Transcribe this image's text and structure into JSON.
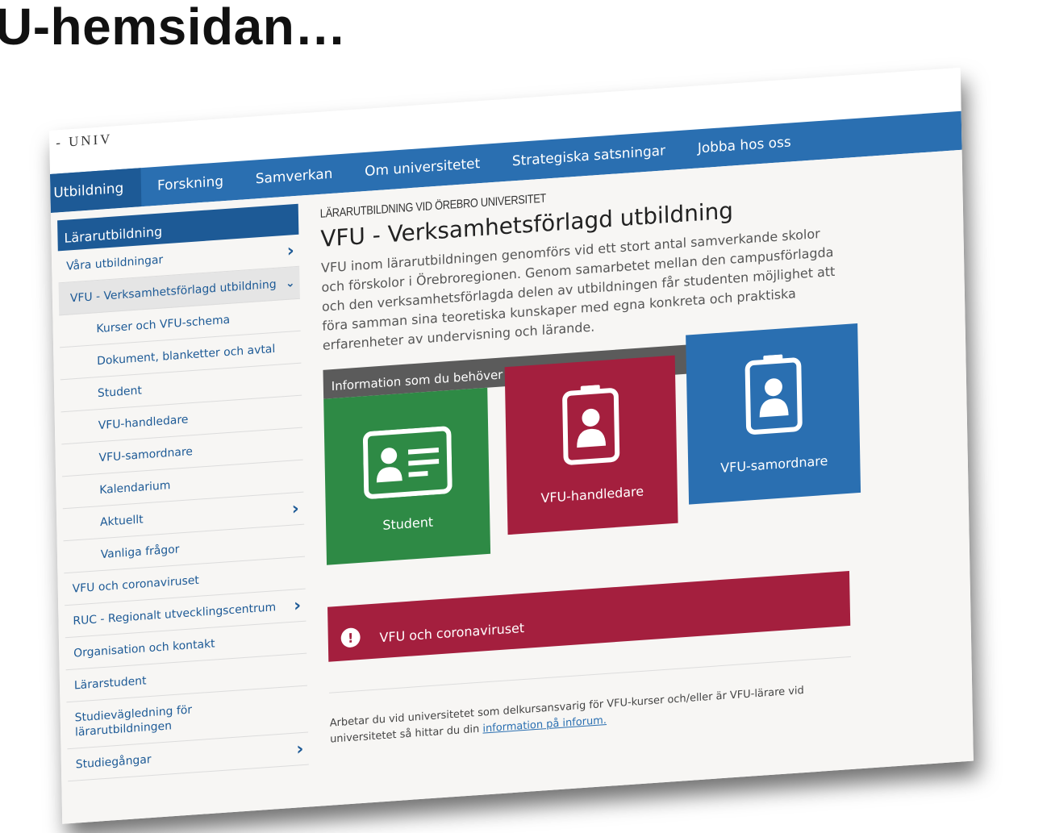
{
  "slide": {
    "title": "U-hemsidan…"
  },
  "site": {
    "logo_text": "- UNIV"
  },
  "topnav": [
    "Utbildning",
    "Forskning",
    "Samverkan",
    "Om universitetet",
    "Strategiska satsningar",
    "Jobba hos oss"
  ],
  "sidebar": {
    "heading": "Lärarutbildning",
    "items": [
      {
        "label": "Våra utbildningar",
        "level": 1,
        "chevron": "right"
      },
      {
        "label": "VFU - Verksamhetsförlagd utbildning",
        "level": 1,
        "chevron": "down",
        "active": true
      },
      {
        "label": "Kurser och VFU-schema",
        "level": 2
      },
      {
        "label": "Dokument, blanketter och avtal",
        "level": 2
      },
      {
        "label": "Student",
        "level": 2
      },
      {
        "label": "VFU-handledare",
        "level": 2
      },
      {
        "label": "VFU-samordnare",
        "level": 2
      },
      {
        "label": "Kalendarium",
        "level": 2
      },
      {
        "label": "Aktuellt",
        "level": 2,
        "chevron": "right"
      },
      {
        "label": "Vanliga frågor",
        "level": 2
      },
      {
        "label": "VFU och coronaviruset",
        "level": 1
      },
      {
        "label": "RUC - Regionalt utvecklingscentrum",
        "level": 1,
        "chevron": "right"
      },
      {
        "label": "Organisation och kontakt",
        "level": 1
      },
      {
        "label": "Lärarstudent",
        "level": 1
      },
      {
        "label": "Studievägledning för lärarutbildningen",
        "level": 1
      },
      {
        "label": "Studiegångar",
        "level": 1,
        "chevron": "right"
      }
    ]
  },
  "main": {
    "kicker": "LÄRARUTBILDNING VID ÖREBRO UNIVERSITET",
    "heading": "VFU - Verksamhetsförlagd utbildning",
    "lead": "VFU inom lärarutbildningen genomförs vid ett stort antal samverkande skolor och förskolor i Örebroregionen. Genom samarbetet mellan den campusförlagda och den verksamhetsförlagda delen av utbildningen får studenten möjlighet att föra samman sina teoretiska kunskaper med egna konkreta och praktiska erfarenheter av undervisning och lärande.",
    "info_heading": "Information som du behöver",
    "tiles": [
      {
        "label": "Student",
        "icon": "id-card-icon",
        "color": "#2e8a45"
      },
      {
        "label": "VFU-handledare",
        "icon": "badge-icon",
        "color": "#a41f3e"
      },
      {
        "label": "VFU-samordnare",
        "icon": "badge-icon",
        "color": "#2a6fb1"
      }
    ],
    "alert": {
      "label": "VFU och coronaviruset",
      "icon": "exclamation-icon",
      "color": "#a41f3e"
    },
    "footnote": {
      "text": "Arbetar du vid universitetet som delkursansvarig för VFU-kurser och/eller är VFU-lärare vid universitetet så hittar du din ",
      "link": "information på inforum.",
      "tail": ""
    }
  },
  "colors": {
    "nav_blue": "#2a6fb1",
    "dark_blue": "#1d5a96",
    "green": "#2e8a45",
    "crimson": "#a41f3e",
    "grey_bar": "#5b5b5b"
  }
}
